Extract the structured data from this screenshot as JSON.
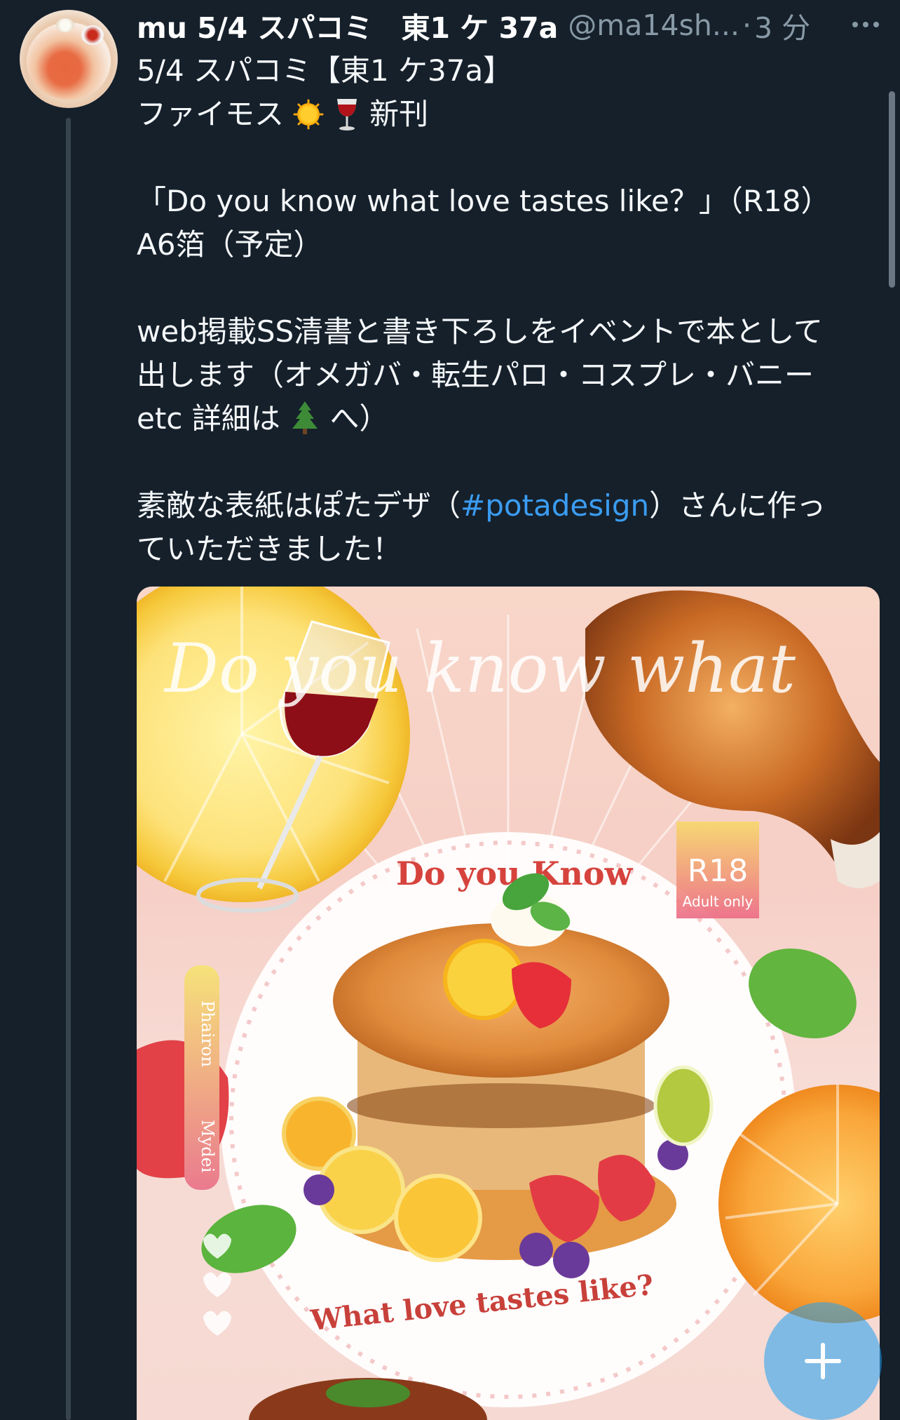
{
  "tweet": {
    "display_name": "mu 5/4 スパコミ　東1 ケ 37a",
    "handle": "@ma14sh...",
    "separator": "·",
    "time": "3 分",
    "lines": {
      "l1": "5/4 スパコミ【東1 ケ37a】",
      "l2_prefix": "ファイモス",
      "l2_suffix": "新刊",
      "l3": "「Do you know what love tastes like？」（R18）",
      "l4": "A6箔（予定）",
      "l5": "web掲載SS清書と書き下ろしをイベントで本として",
      "l6": "出します（オメガバ・転生パロ・コスプレ・バニー",
      "l7_prefix": "etc 詳細は",
      "l7_suffix": "へ）",
      "l8_prefix": "素敵な表紙はぽたデザ（",
      "l8_hashtag": "#potadesign",
      "l8_suffix": "）さんに作っ",
      "l9": "ていただきました！"
    },
    "icons": {
      "avatar": "pancake-avatar",
      "more": "more-dots-icon",
      "sun": "sun-emoji",
      "wine": "wine-glass-emoji",
      "tree": "evergreen-tree-emoji",
      "compose": "plus-icon"
    }
  },
  "media": {
    "cover_script_title": "Do you know what",
    "top_arc": "Do you Know",
    "bottom_arc": "What love tastes like?",
    "badge_title": "R18",
    "badge_sub": "Adult only",
    "side_ribbon_1": "Phairon",
    "side_ribbon_2": "Mydei"
  },
  "colors": {
    "background": "#15202b",
    "hashtag": "#3b9cf1",
    "secondary_text": "#8899a6",
    "fab": "#1da1f2"
  }
}
